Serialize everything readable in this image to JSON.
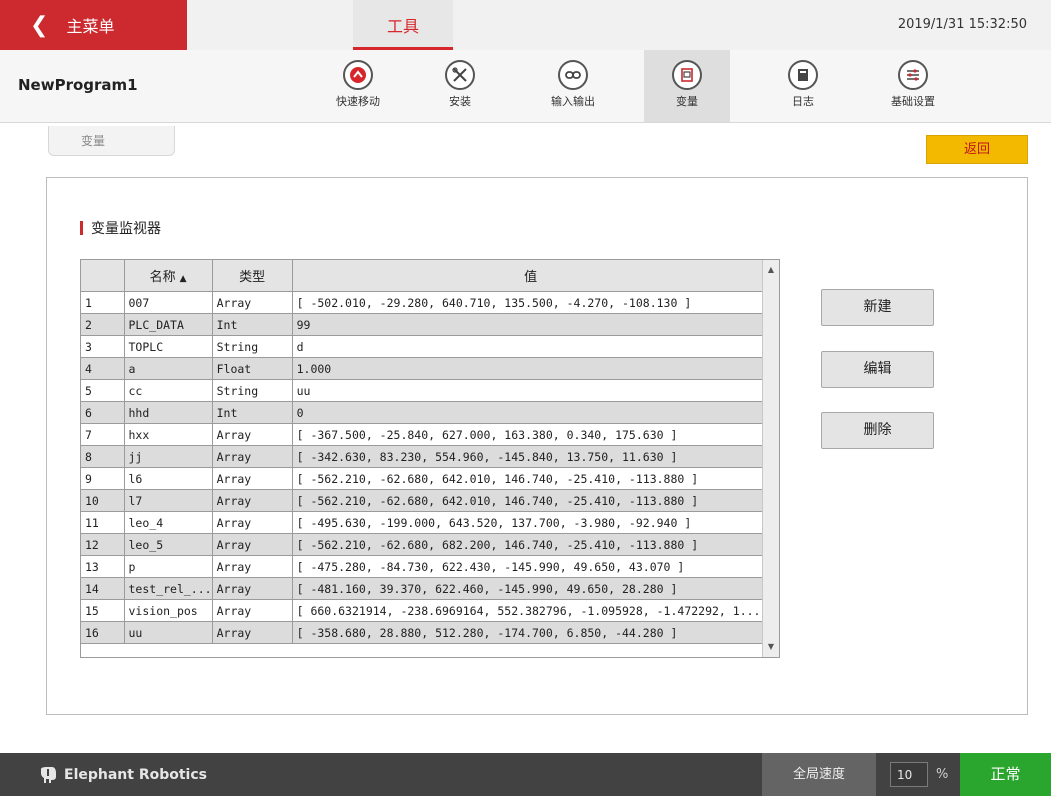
{
  "topbar": {
    "back_label": "主菜单",
    "active_tab": "工具",
    "datetime": "2019/1/31 15:32:50"
  },
  "toolbar": {
    "program_name": "NewProgram1",
    "tools": [
      {
        "label": "快速移动",
        "icon": "fast-move-icon"
      },
      {
        "label": "安装",
        "icon": "install-icon"
      },
      {
        "label": "输入输出",
        "icon": "io-icon"
      },
      {
        "label": "变量",
        "icon": "variable-icon"
      },
      {
        "label": "日志",
        "icon": "log-icon"
      },
      {
        "label": "基础设置",
        "icon": "settings-icon"
      }
    ],
    "active_tool": "变量"
  },
  "subtab": {
    "label": "变量"
  },
  "back_button": {
    "label": "返回"
  },
  "monitor": {
    "title": "变量监视器",
    "columns": [
      "名称",
      "类型",
      "值"
    ],
    "rows": [
      {
        "n": "1",
        "name": "007",
        "type": "Array",
        "value": "[ -502.010, -29.280, 640.710, 135.500, -4.270, -108.130 ]"
      },
      {
        "n": "2",
        "name": "PLC_DATA",
        "type": "Int",
        "value": "99"
      },
      {
        "n": "3",
        "name": "TOPLC",
        "type": "String",
        "value": "d"
      },
      {
        "n": "4",
        "name": "a",
        "type": "Float",
        "value": "1.000"
      },
      {
        "n": "5",
        "name": "cc",
        "type": "String",
        "value": "uu"
      },
      {
        "n": "6",
        "name": "hhd",
        "type": "Int",
        "value": "0"
      },
      {
        "n": "7",
        "name": "hxx",
        "type": "Array",
        "value": "[ -367.500, -25.840, 627.000, 163.380, 0.340, 175.630 ]"
      },
      {
        "n": "8",
        "name": "jj",
        "type": "Array",
        "value": "[ -342.630, 83.230, 554.960, -145.840, 13.750, 11.630 ]"
      },
      {
        "n": "9",
        "name": "l6",
        "type": "Array",
        "value": "[ -562.210, -62.680, 642.010, 146.740, -25.410, -113.880 ]"
      },
      {
        "n": "10",
        "name": "l7",
        "type": "Array",
        "value": "[ -562.210, -62.680, 642.010, 146.740, -25.410, -113.880 ]"
      },
      {
        "n": "11",
        "name": "leo_4",
        "type": "Array",
        "value": "[ -495.630, -199.000, 643.520, 137.700, -3.980, -92.940 ]"
      },
      {
        "n": "12",
        "name": "leo_5",
        "type": "Array",
        "value": "[ -562.210, -62.680, 682.200, 146.740, -25.410, -113.880 ]"
      },
      {
        "n": "13",
        "name": "p",
        "type": "Array",
        "value": "[ -475.280, -84.730, 622.430, -145.990, 49.650, 43.070 ]"
      },
      {
        "n": "14",
        "name": "test_rel_...",
        "type": "Array",
        "value": "[ -481.160, 39.370, 622.460, -145.990, 49.650, 28.280 ]"
      },
      {
        "n": "15",
        "name": "vision_pos",
        "type": "Array",
        "value": "[ 660.6321914, -238.6969164, 552.382796, -1.095928, -1.472292, 1..."
      },
      {
        "n": "16",
        "name": "uu",
        "type": "Array",
        "value": "[ -358.680, 28.880, 512.280, -174.700, 6.850, -44.280 ]"
      }
    ]
  },
  "actions": {
    "new_label": "新建",
    "edit_label": "编辑",
    "delete_label": "删除"
  },
  "footer": {
    "brand": "Elephant Robotics",
    "speed_label": "全局速度",
    "speed_value": "10",
    "speed_unit": "%",
    "status": "正常"
  },
  "colors": {
    "accent_red": "#cc2a2f",
    "back_button": "#f2b900",
    "status_green": "#2aa52d",
    "footer_dark": "#424242"
  }
}
